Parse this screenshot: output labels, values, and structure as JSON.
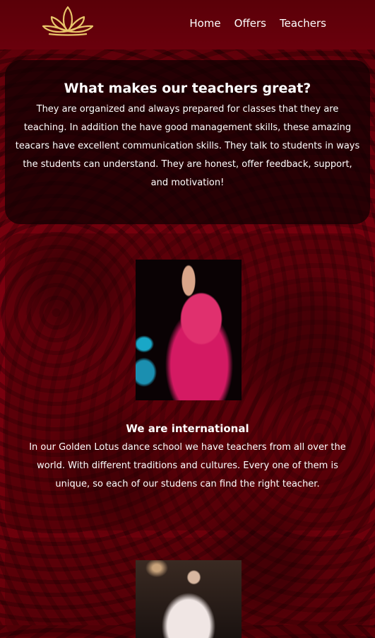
{
  "nav": {
    "logo_icon": "lotus-icon",
    "links": [
      {
        "label": "Home"
      },
      {
        "label": "Offers"
      },
      {
        "label": "Teachers"
      }
    ]
  },
  "intro": {
    "title": "What makes our teachers great?",
    "paragraph": "They are organized and always prepared for classes that they are teaching. In addition the have good management skills, these amazing teacars have excellent communication skills. They talk to students in ways the students can understand. They are honest, offer feedback, support, and motivation!"
  },
  "international": {
    "title": "We are international",
    "paragraph": "In our Golden Lotus dance school we have teachers from all over the world. With different traditions and cultures. Every one of them is unique, so each of our studens can find the right teacher."
  },
  "colors": {
    "gold": "#e8c56a",
    "background": "#6a000c"
  }
}
